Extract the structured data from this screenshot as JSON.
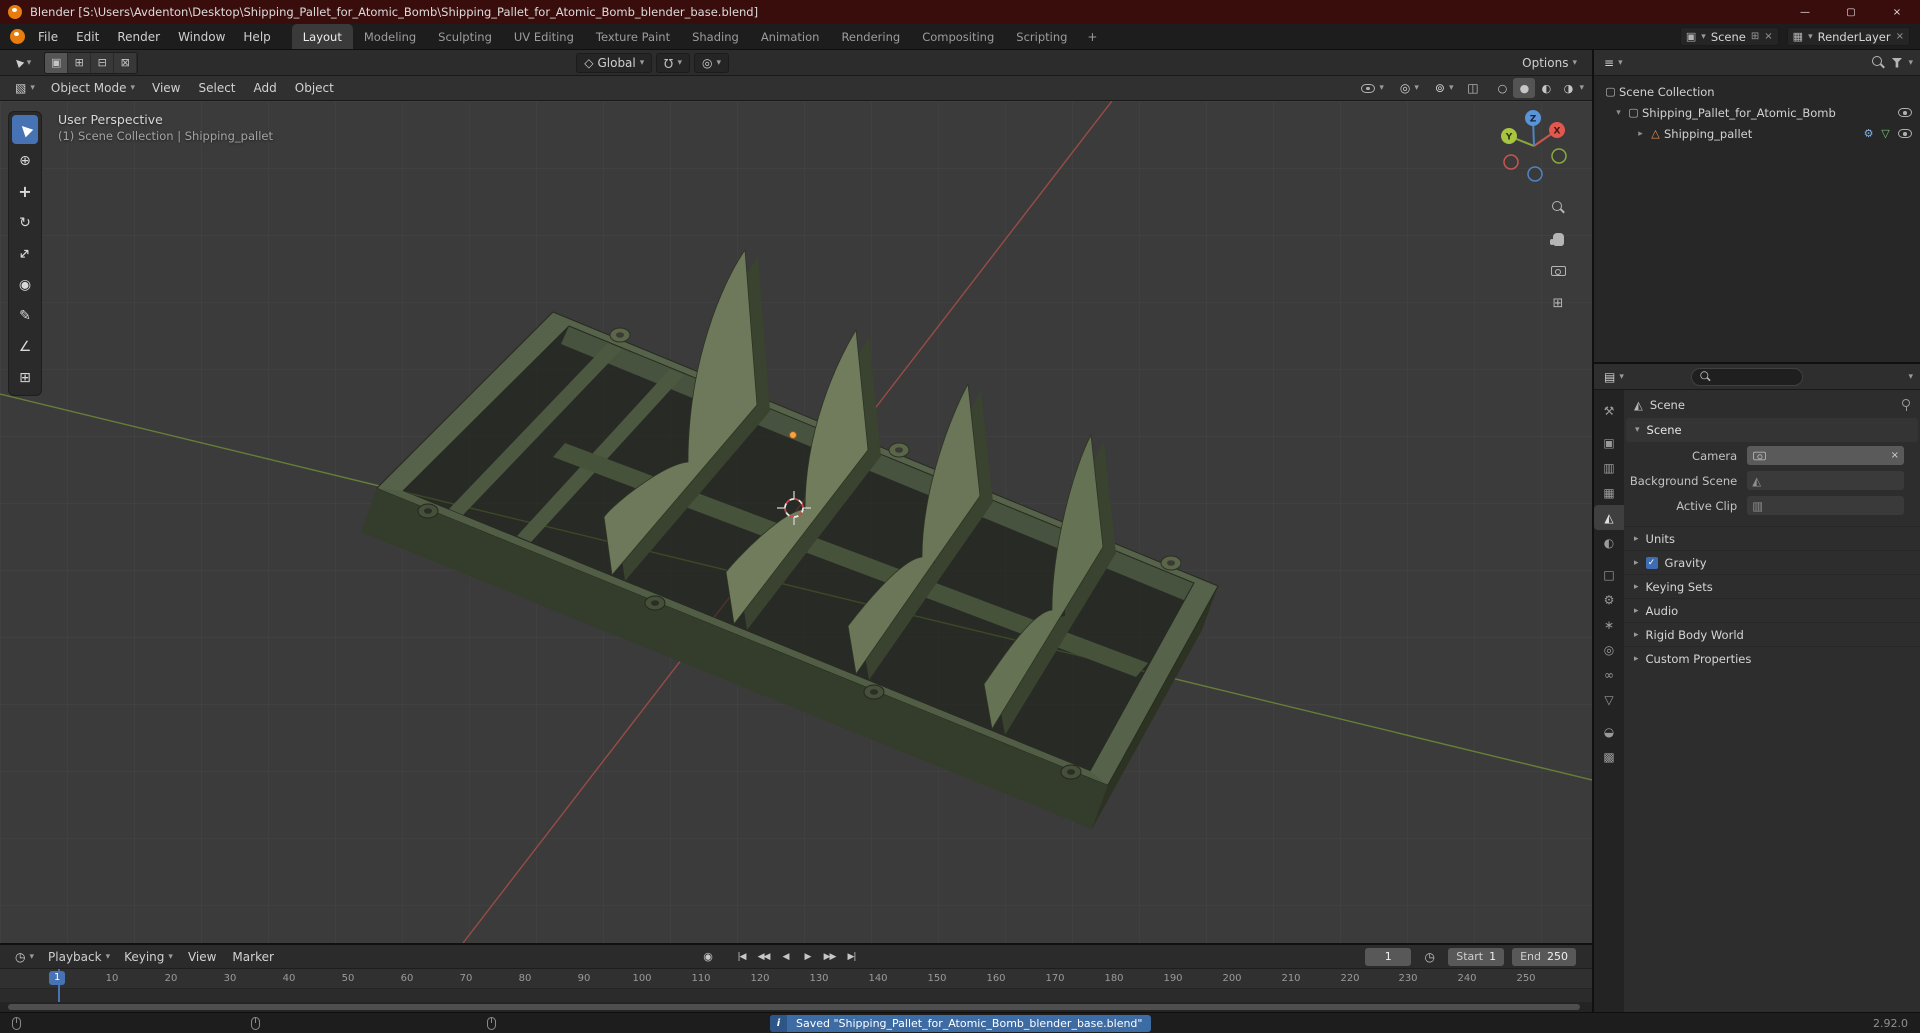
{
  "window": {
    "title": "Blender [S:\\Users\\Avdenton\\Desktop\\Shipping_Pallet_for_Atomic_Bomb\\Shipping_Pallet_for_Atomic_Bomb_blender_base.blend]",
    "controls": {
      "minimize": "—",
      "maximize": "▢",
      "close": "×"
    }
  },
  "topbar": {
    "menus": [
      "File",
      "Edit",
      "Render",
      "Window",
      "Help"
    ],
    "workspaces": [
      "Layout",
      "Modeling",
      "Sculpting",
      "UV Editing",
      "Texture Paint",
      "Shading",
      "Animation",
      "Rendering",
      "Compositing",
      "Scripting"
    ],
    "active_workspace": "Layout",
    "add_workspace": "+",
    "scene_selector": {
      "value": "Scene"
    },
    "view_layer_selector": {
      "value": "RenderLayer"
    }
  },
  "tool_settings": {
    "orientation": {
      "label": "Global"
    },
    "options": {
      "label": "Options"
    }
  },
  "viewport": {
    "header": {
      "mode": "Object Mode",
      "menus": [
        "View",
        "Select",
        "Add",
        "Object"
      ]
    },
    "overlay": {
      "line1": "User Perspective",
      "line2": "(1) Scene Collection | Shipping_pallet"
    },
    "gizmo": {
      "x": "X",
      "y": "Y",
      "z": "Z"
    }
  },
  "outliner": {
    "rows": [
      {
        "label": "Scene Collection"
      },
      {
        "label": "Shipping_Pallet_for_Atomic_Bomb"
      },
      {
        "label": "Shipping_pallet"
      }
    ]
  },
  "properties": {
    "breadcrumb": "Scene",
    "scene_panel": {
      "title": "Scene",
      "fields": [
        {
          "label": "Camera"
        },
        {
          "label": "Background Scene"
        },
        {
          "label": "Active Clip"
        }
      ]
    },
    "collapsed_panels": [
      "Units",
      "Gravity",
      "Keying Sets",
      "Audio",
      "Rigid Body World",
      "Custom Properties"
    ]
  },
  "prop_tabs": [
    {
      "name": "tool",
      "glyph": "⚒"
    },
    {
      "name": "render",
      "glyph": "▣"
    },
    {
      "name": "output",
      "glyph": "▥"
    },
    {
      "name": "view-layer",
      "glyph": "▦"
    },
    {
      "name": "scene",
      "glyph": "◭"
    },
    {
      "name": "world",
      "glyph": "◐"
    },
    {
      "name": "object",
      "glyph": "□"
    },
    {
      "name": "modifiers",
      "glyph": "⚙"
    },
    {
      "name": "particles",
      "glyph": "∗"
    },
    {
      "name": "physics",
      "glyph": "◎"
    },
    {
      "name": "constraints",
      "glyph": "∞"
    },
    {
      "name": "object-data",
      "glyph": "▽"
    },
    {
      "name": "material",
      "glyph": "◒"
    },
    {
      "name": "texture",
      "glyph": "▩"
    }
  ],
  "timeline": {
    "menus": [
      "Playback",
      "Keying",
      "View",
      "Marker"
    ],
    "current_frame": "1",
    "start": {
      "label": "Start",
      "value": "1"
    },
    "end": {
      "label": "End",
      "value": "250"
    },
    "ticks": [
      "10",
      "20",
      "30",
      "40",
      "50",
      "60",
      "70",
      "80",
      "90",
      "100",
      "110",
      "120",
      "130",
      "140",
      "150",
      "160",
      "170",
      "180",
      "190",
      "200",
      "210",
      "220",
      "230",
      "240",
      "250"
    ]
  },
  "status": {
    "message": "Saved \"Shipping_Pallet_for_Atomic_Bomb_blender_base.blend\"",
    "version": "2.92.0"
  },
  "colors": {
    "accent_blue": "#4772b3",
    "titlebar_maroon": "#3a0d0d",
    "axis_x_red": "#a84f48",
    "axis_y_green": "#6e8c38",
    "pallet_green": "#6d795a"
  },
  "icons": {
    "dropdown": "▾",
    "expand": "▸",
    "collapse": "▾",
    "editor_3d_viewport": "▧",
    "editor_outliner": "≡",
    "editor_properties": "▤",
    "editor_timeline": "◷",
    "select_tool": "▶",
    "cursor_tool": "⊕",
    "move_tool": "+",
    "rotate_tool": "↻",
    "scale_tool": "↔",
    "transform_tool": "◉",
    "annotate_tool": "✎",
    "measure_tool": "∠",
    "add_cube_tool": "⊞",
    "select_new": "▣",
    "select_extend": "⊞",
    "select_subtract": "⊟",
    "select_intersect": "⊠",
    "orientation": "◇",
    "snap_magnet": "Ω",
    "proportional": "◎",
    "gizmos": "◎",
    "overlays": "⊚",
    "xray": "◫",
    "shading_wireframe": "○",
    "shading_solid": "●",
    "shading_material": "◐",
    "shading_rendered": "◑",
    "scene_widget": "▣",
    "view_layer_widget": "▦",
    "new": "⊞",
    "clear": "×",
    "collection": "▢",
    "mesh_object": "△",
    "modifier_wrench": "⚙",
    "mesh_data": "▽",
    "scene_prop": "◭",
    "clip": "▥",
    "record": "◉",
    "jump_start": "|◀",
    "prev_key": "◀◀",
    "play_back": "◀",
    "play": "▶",
    "next_key": "▶▶",
    "jump_end": "▶|",
    "auto_key_clock": "◷",
    "check": "✓",
    "info": "i",
    "grid_ortho": "⊞",
    "pin": "⊙"
  }
}
